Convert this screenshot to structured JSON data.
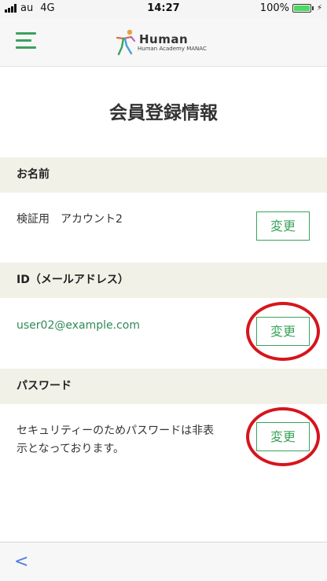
{
  "status_bar": {
    "carrier": "au",
    "network": "4G",
    "time": "14:27",
    "battery": "100%",
    "battery_level": 1.0
  },
  "header": {
    "logo_title": "Human",
    "logo_subtitle": "Human Academy MANAC",
    "menu_icon": "hamburger-icon"
  },
  "page": {
    "title": "会員登録情報"
  },
  "sections": [
    {
      "header": "お名前",
      "value": "検証用　アカウント2",
      "button": "変更"
    },
    {
      "header": "ID（メールアドレス）",
      "value": "user02@example.com",
      "button": "変更"
    },
    {
      "header": "パスワード",
      "value_line1": "セキュリティーのためパスワードは非表",
      "value_line2": "示となっております。",
      "button": "変更"
    }
  ],
  "bottom_bar": {
    "back_label": "<"
  },
  "colors": {
    "accent": "#3aa35b",
    "section_bg": "#f2f1e8",
    "annotation": "#d6151b"
  }
}
